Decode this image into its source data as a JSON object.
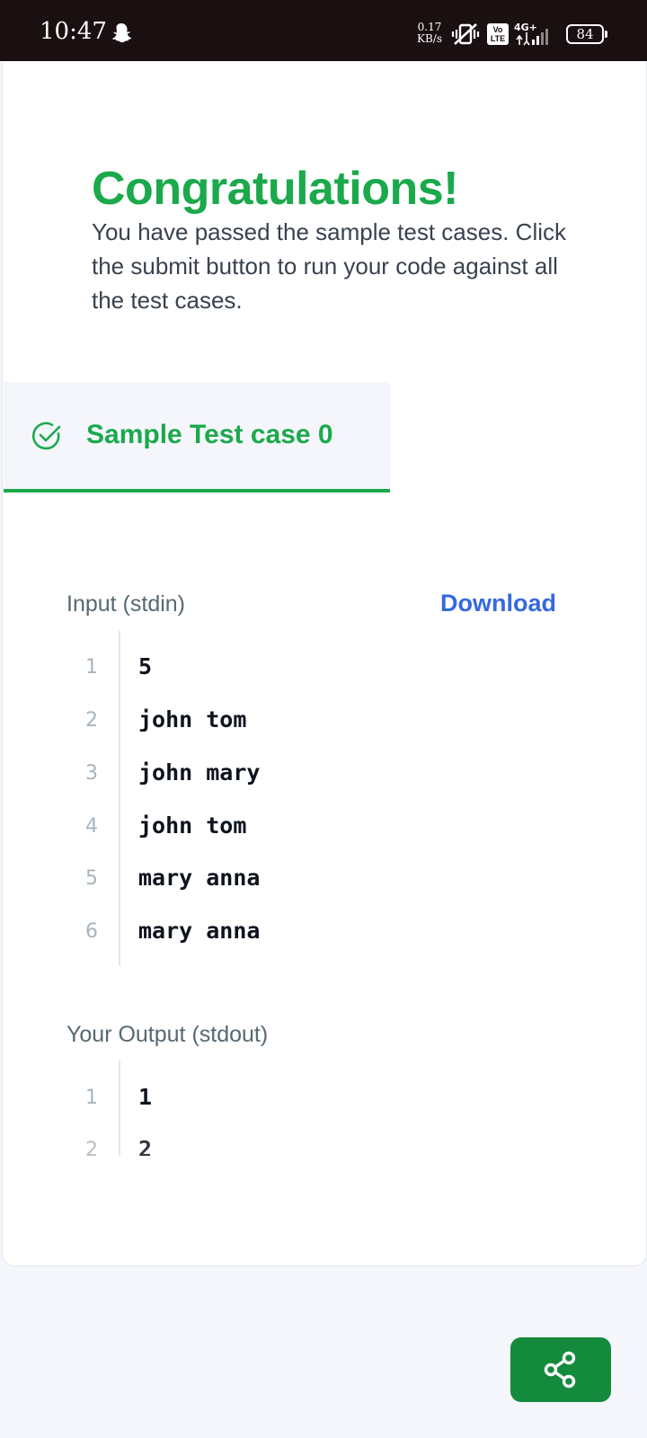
{
  "status_bar": {
    "time": "10:47",
    "net_speed_value": "0.17",
    "net_speed_unit": "KB/s",
    "volte": "Vo\nLTE",
    "network_type": "4G+",
    "battery": "84"
  },
  "result": {
    "title": "Congratulations!",
    "message": "You have passed the sample test cases. Click the submit button to run your code against all the test cases."
  },
  "tabs": [
    {
      "label": "Sample Test case 0",
      "status": "passed"
    }
  ],
  "input": {
    "label": "Input (stdin)",
    "download_label": "Download",
    "lines": [
      {
        "no": "1",
        "text": "5"
      },
      {
        "no": "2",
        "text": "john tom"
      },
      {
        "no": "3",
        "text": "john mary"
      },
      {
        "no": "4",
        "text": "john tom"
      },
      {
        "no": "5",
        "text": "mary anna"
      },
      {
        "no": "6",
        "text": "mary anna"
      }
    ]
  },
  "output": {
    "label": "Your Output (stdout)",
    "lines": [
      {
        "no": "1",
        "text": "1"
      },
      {
        "no": "2",
        "text": "2"
      }
    ]
  },
  "colors": {
    "success": "#1ba94c",
    "link": "#3569e0",
    "share_button": "#138a3c"
  },
  "icons": {
    "tab_status": "check-circle-icon",
    "fab": "share-icon"
  }
}
